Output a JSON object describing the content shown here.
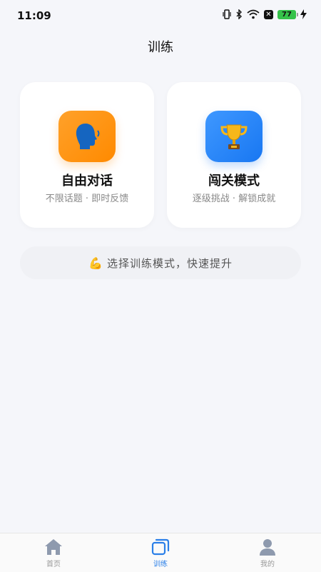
{
  "status_bar": {
    "time": "11:09",
    "battery": "77"
  },
  "header": {
    "title": "训练"
  },
  "cards": [
    {
      "title": "自由对话",
      "subtitle": "不限话题 · 即时反馈",
      "icon": "speaking-head-icon",
      "color": "#ff9a1a"
    },
    {
      "title": "闯关模式",
      "subtitle": "逐级挑战 · 解锁成就",
      "icon": "trophy-icon",
      "color": "#2b86f5"
    }
  ],
  "tip": {
    "emoji": "💪",
    "text": "选择训练模式，快速提升"
  },
  "tabbar": {
    "items": [
      {
        "label": "首页",
        "icon": "home-icon",
        "active": false
      },
      {
        "label": "训练",
        "icon": "training-icon",
        "active": true
      },
      {
        "label": "我的",
        "icon": "profile-icon",
        "active": false
      }
    ],
    "active_color": "#2a7fe8",
    "inactive_color": "#999999"
  }
}
